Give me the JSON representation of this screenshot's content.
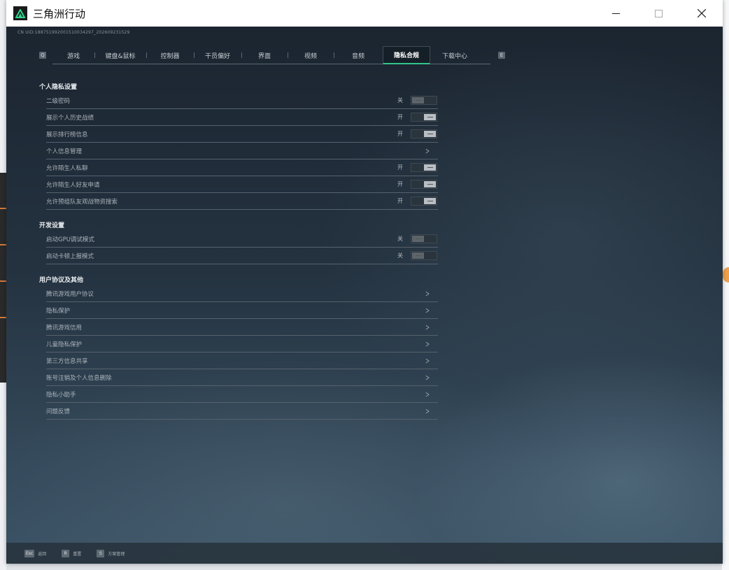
{
  "window": {
    "title": "三角洲行动",
    "minimize_icon": "minimize-icon",
    "maximize_icon": "maximize-icon",
    "close_icon": "close-icon"
  },
  "game": {
    "uid": "CN UID:1887519920015100342​97_202609231529"
  },
  "tabbar": {
    "prev_key": "Q",
    "next_key": "E",
    "tabs": [
      {
        "label": "游戏",
        "active": false
      },
      {
        "label": "键盘&鼠标",
        "active": false
      },
      {
        "label": "控制器",
        "active": false
      },
      {
        "label": "干员偏好",
        "active": false
      },
      {
        "label": "界面",
        "active": false
      },
      {
        "label": "视频",
        "active": false
      },
      {
        "label": "音频",
        "active": false
      },
      {
        "label": "隐私合规",
        "active": true
      },
      {
        "label": "下载中心",
        "active": false
      }
    ]
  },
  "sections": {
    "personal": {
      "title": "个人隐私设置",
      "rows": [
        {
          "label": "二级密码",
          "state": "关",
          "type": "toggle",
          "on": false
        },
        {
          "label": "展示个人历史战绩",
          "state": "开",
          "type": "toggle",
          "on": true
        },
        {
          "label": "展示排行榜信息",
          "state": "开",
          "type": "toggle",
          "on": true
        },
        {
          "label": "个人信息管理",
          "type": "link"
        },
        {
          "label": "允许陌生人私聊",
          "state": "开",
          "type": "toggle",
          "on": true
        },
        {
          "label": "允许陌生人好友申请",
          "state": "开",
          "type": "toggle",
          "on": true
        },
        {
          "label": "允许预组队友观战物资搜索",
          "state": "开",
          "type": "toggle",
          "on": true
        }
      ]
    },
    "dev": {
      "title": "开发设置",
      "rows": [
        {
          "label": "启动GPU调试模式",
          "state": "关",
          "type": "toggle",
          "on": false
        },
        {
          "label": "启动卡顿上报模式",
          "state": "关",
          "type": "toggle",
          "on": false
        }
      ]
    },
    "agreements": {
      "title": "用户协议及其他",
      "rows": [
        {
          "label": "腾讯游戏用户协议",
          "type": "link"
        },
        {
          "label": "隐私保护",
          "type": "link"
        },
        {
          "label": "腾讯游戏信用",
          "type": "link"
        },
        {
          "label": "儿童隐私保护",
          "type": "link"
        },
        {
          "label": "第三方信息共享",
          "type": "link"
        },
        {
          "label": "账号注销及个人信息删除",
          "type": "link"
        },
        {
          "label": "隐私小助手",
          "type": "link"
        },
        {
          "label": "问题反馈",
          "type": "link"
        }
      ]
    }
  },
  "footer": {
    "hints": [
      {
        "key": "Esc",
        "label": "返回"
      },
      {
        "key": "R",
        "label": "重置"
      },
      {
        "key": "S",
        "label": "方案管理"
      }
    ]
  },
  "colors": {
    "accent": "#33c48a",
    "text": "#aab3ba"
  }
}
